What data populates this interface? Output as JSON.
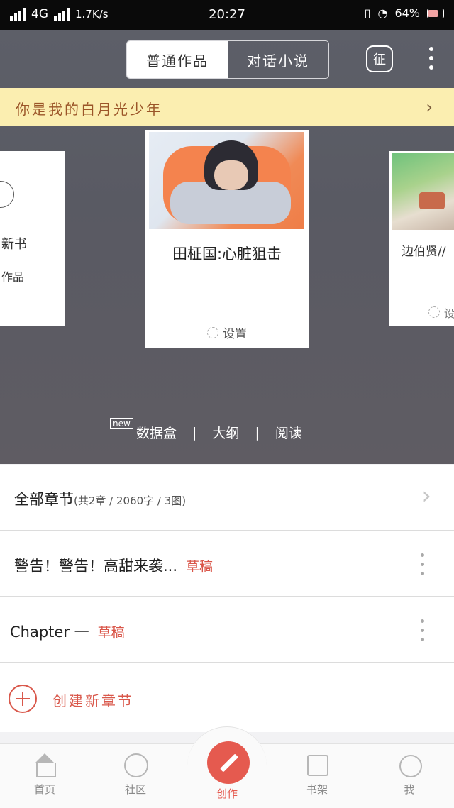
{
  "status_bar": {
    "network": "4G",
    "speed": "1.7K/s",
    "time": "20:27",
    "battery": "64%"
  },
  "header": {
    "segment": {
      "tabs": [
        {
          "label": "普通作品",
          "active": true
        },
        {
          "label": "对话小说",
          "active": false
        }
      ]
    },
    "badge": "征"
  },
  "banner": {
    "text": "你是我的白月光少年"
  },
  "carousel": {
    "left_card": {
      "label_new": "新书",
      "label_work": "作品"
    },
    "center_card": {
      "title": "田柾国:心脏狙击",
      "setting": "设置"
    },
    "right_card": {
      "title": "边伯贤//",
      "setting": "设"
    }
  },
  "toolbar": {
    "new_tag": "new",
    "items": [
      "数据盒",
      "大纲",
      "阅读"
    ]
  },
  "chapters": {
    "all_label": "全部章节",
    "all_meta": "(共2章 / 2060字 / 3图)",
    "items": [
      {
        "title": "警告！警告！高甜来袭...",
        "status": "草稿"
      },
      {
        "title": "Chapter 一",
        "status": "草稿"
      }
    ],
    "create_label": "创建新章节"
  },
  "tabbar": {
    "items": [
      "首页",
      "社区",
      "创作",
      "书架",
      "我"
    ]
  },
  "colors": {
    "accent": "#e55a4f",
    "banner_bg": "#fbeeb0",
    "hero_bg": "#5d5f68"
  }
}
